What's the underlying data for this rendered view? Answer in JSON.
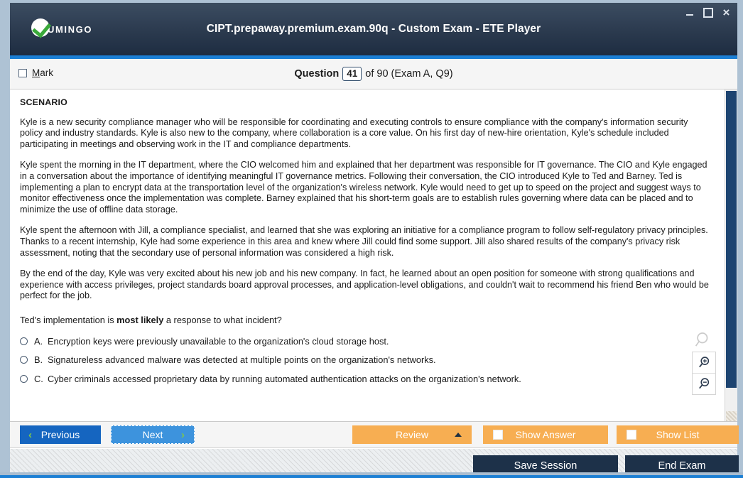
{
  "window": {
    "title": "CIPT.prepaway.premium.exam.90q - Custom Exam - ETE Player",
    "logo_text": "UMINGO",
    "controls": {
      "minimize": "minimize-icon",
      "maximize": "maximize-icon",
      "close": "×"
    },
    "accent_color": "#1b7fd4",
    "titlebar_color": "#2b3a4e"
  },
  "question_header": {
    "mark_label_underlined": "M",
    "mark_label_rest": "ark",
    "counter_label": "Question",
    "counter_number": "41",
    "counter_rest": "of 90 (Exam A, Q9)"
  },
  "question": {
    "scenario_heading": "SCENARIO",
    "paragraphs": [
      "Kyle is a new security compliance manager who will be responsible for coordinating and executing controls to ensure compliance with the company's information security policy and industry standards. Kyle is also new to the company, where collaboration is a core value. On his first day of new-hire orientation, Kyle's schedule included participating in meetings and observing work in the IT and compliance departments.",
      "Kyle spent the morning in the IT department, where the CIO welcomed him and explained that her department was responsible for IT governance. The CIO and Kyle engaged in a conversation about the importance of identifying meaningful IT governance metrics. Following their conversation, the CIO introduced Kyle to Ted and Barney. Ted is implementing a plan to encrypt data at the transportation level of the organization's wireless network. Kyle would need to get up to speed on the project and suggest ways to monitor effectiveness once the implementation was complete. Barney explained that his short-term goals are to establish rules governing where data can be placed and to minimize the use of offline data storage.",
      "Kyle spent the afternoon with Jill, a compliance specialist, and learned that she was exploring an initiative for a compliance program to follow self-regulatory privacy principles. Thanks to a recent internship, Kyle had some experience in this area and knew where Jill could find some support. Jill also shared results of the company's privacy risk assessment, noting that the secondary use of personal information was considered a high risk.",
      "By the end of the day, Kyle was very excited about his new job and his new company. In fact, he learned about an open position for someone with strong qualifications and experience with access privileges, project standards board approval processes, and application-level obligations, and couldn't wait to recommend his friend Ben who would be perfect for the job."
    ],
    "prompt_before": "Ted's implementation is ",
    "prompt_bold": "most likely",
    "prompt_after": " a response to what incident?",
    "answers": [
      {
        "letter": "A.",
        "text": "Encryption keys were previously unavailable to the organization's cloud storage host.",
        "selected": false
      },
      {
        "letter": "B.",
        "text": "Signatureless advanced malware was detected at multiple points on the organization's networks.",
        "selected": false
      },
      {
        "letter": "C.",
        "text": "Cyber criminals accessed proprietary data by running automated authentication attacks on the organization's network.",
        "selected": false
      }
    ]
  },
  "zoom_tools": {
    "ghost": "magnifier-icon",
    "zoom_in": "zoom-in-icon",
    "zoom_out": "zoom-out-icon"
  },
  "toolbar": {
    "previous_label": "Previous",
    "previous_chevron": "‹",
    "next_label": "Next",
    "next_chevron": "›",
    "review_label": "Review",
    "show_answer_label": "Show Answer",
    "show_list_label": "Show List",
    "orange_color": "#f7ae52",
    "previous_color": "#1565c0",
    "next_color": "#3d93dd"
  },
  "footer": {
    "save_session_label": "Save Session",
    "end_exam_label": "End Exam",
    "button_color": "#1d3149"
  }
}
